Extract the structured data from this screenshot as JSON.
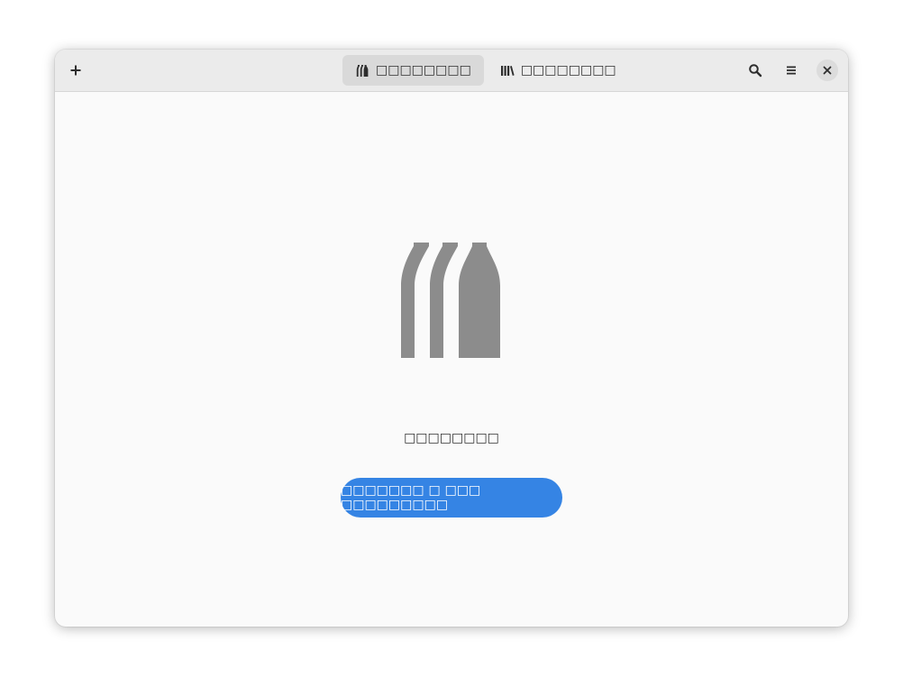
{
  "header": {
    "tabs": [
      {
        "label": "□□□□□□□□",
        "icon": "bottles-icon",
        "active": true
      },
      {
        "label": "□□□□□□□□",
        "icon": "library-icon",
        "active": false
      }
    ],
    "buttons": {
      "add_icon": "plus-icon",
      "search_icon": "search-icon",
      "menu_icon": "hamburger-menu-icon",
      "close_icon": "close-icon"
    }
  },
  "empty_state": {
    "icon": "bottles-icon",
    "title": "□□□□□□□□",
    "button_label": "□□□□□□□ □ □□□ □□□□□□□□□"
  },
  "colors": {
    "accent": "#3584e4",
    "headerbar": "#ebebeb",
    "window_bg": "#fafafa",
    "icon_gray": "#8c8c8c"
  }
}
